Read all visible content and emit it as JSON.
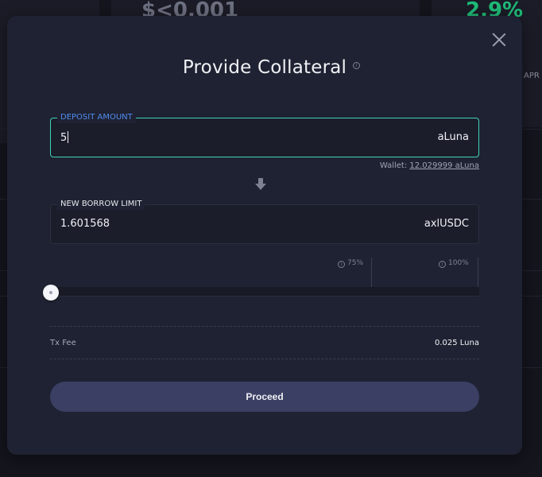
{
  "background": {
    "value_text": "$<0.001",
    "percent_text": "2.9%",
    "apr_label": "APR"
  },
  "modal": {
    "title": "Provide Collateral",
    "title_info_icon": "info-icon",
    "close_icon": "close-icon",
    "deposit": {
      "label": "DEPOSIT AMOUNT",
      "value": "5",
      "unit": "aLuna"
    },
    "wallet": {
      "label": "Wallet:",
      "amount": "12.029999 aLuna"
    },
    "arrow_icon": "arrow-down-icon",
    "borrow": {
      "label": "NEW BORROW LIMIT",
      "value": "1.601568",
      "unit": "axlUSDC"
    },
    "slider": {
      "marker_75": "75%",
      "marker_100": "100%",
      "level": 0
    },
    "tx_fee": {
      "label": "Tx Fee",
      "value": "0.025 Luna"
    },
    "proceed_label": "Proceed"
  },
  "colors": {
    "accent_focus": "#3fd3b5",
    "label_blue": "#4f8df0",
    "button_bg": "#3a3f63",
    "positive_green": "#1fbd7a"
  }
}
